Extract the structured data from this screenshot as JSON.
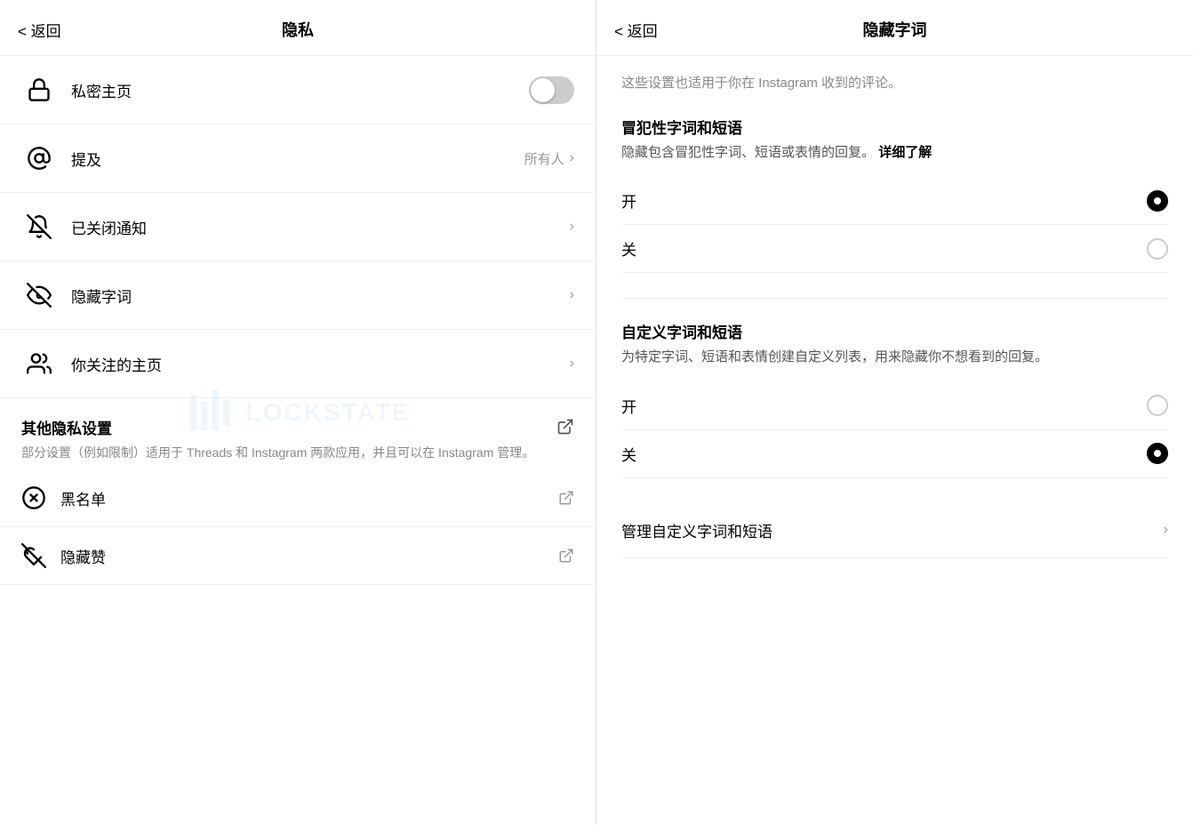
{
  "left": {
    "header": {
      "back_label": "< 返回",
      "title": "隐私"
    },
    "menu_items": [
      {
        "id": "private-home",
        "label": "私密主页",
        "icon": "lock",
        "type": "toggle",
        "toggle_on": false
      },
      {
        "id": "mentions",
        "label": "提及",
        "icon": "at",
        "type": "value",
        "value": "所有人"
      },
      {
        "id": "muted-notifications",
        "label": "已关闭通知",
        "icon": "bell-off",
        "type": "arrow"
      },
      {
        "id": "hidden-words",
        "label": "隐藏字词",
        "icon": "eye-off",
        "type": "arrow"
      },
      {
        "id": "following-home",
        "label": "你关注的主页",
        "icon": "people",
        "type": "arrow"
      }
    ],
    "other_privacy": {
      "title": "其他隐私设置",
      "icon": "external-link",
      "desc": "部分设置（例如限制）适用于 Threads 和 Instagram 两款应用，并且可以在 Instagram 管理。"
    },
    "extra_items": [
      {
        "id": "blacklist",
        "label": "黑名单",
        "icon": "circle-x",
        "type": "external"
      },
      {
        "id": "hidden-likes",
        "label": "隐藏赞",
        "icon": "heart-off",
        "type": "external"
      }
    ],
    "watermark": "LOCKSTATE"
  },
  "right": {
    "header": {
      "back_label": "< 返回",
      "title": "隐藏字词"
    },
    "description": "这些设置也适用于你在 Instagram 收到的评论。",
    "offensive_section": {
      "title": "冒犯性字词和短语",
      "desc": "隐藏包含冒犯性字词、短语或表情的回复。",
      "desc_link": "详细了解",
      "options": [
        {
          "label": "开",
          "selected": true
        },
        {
          "label": "关",
          "selected": false
        }
      ]
    },
    "custom_section": {
      "title": "自定义字词和短语",
      "desc": "为特定字词、短语和表情创建自定义列表，用来隐藏你不想看到的回复。",
      "options": [
        {
          "label": "开",
          "selected": false
        },
        {
          "label": "关",
          "selected": true
        }
      ]
    },
    "manage_item": {
      "label": "管理自定义字词和短语"
    }
  }
}
